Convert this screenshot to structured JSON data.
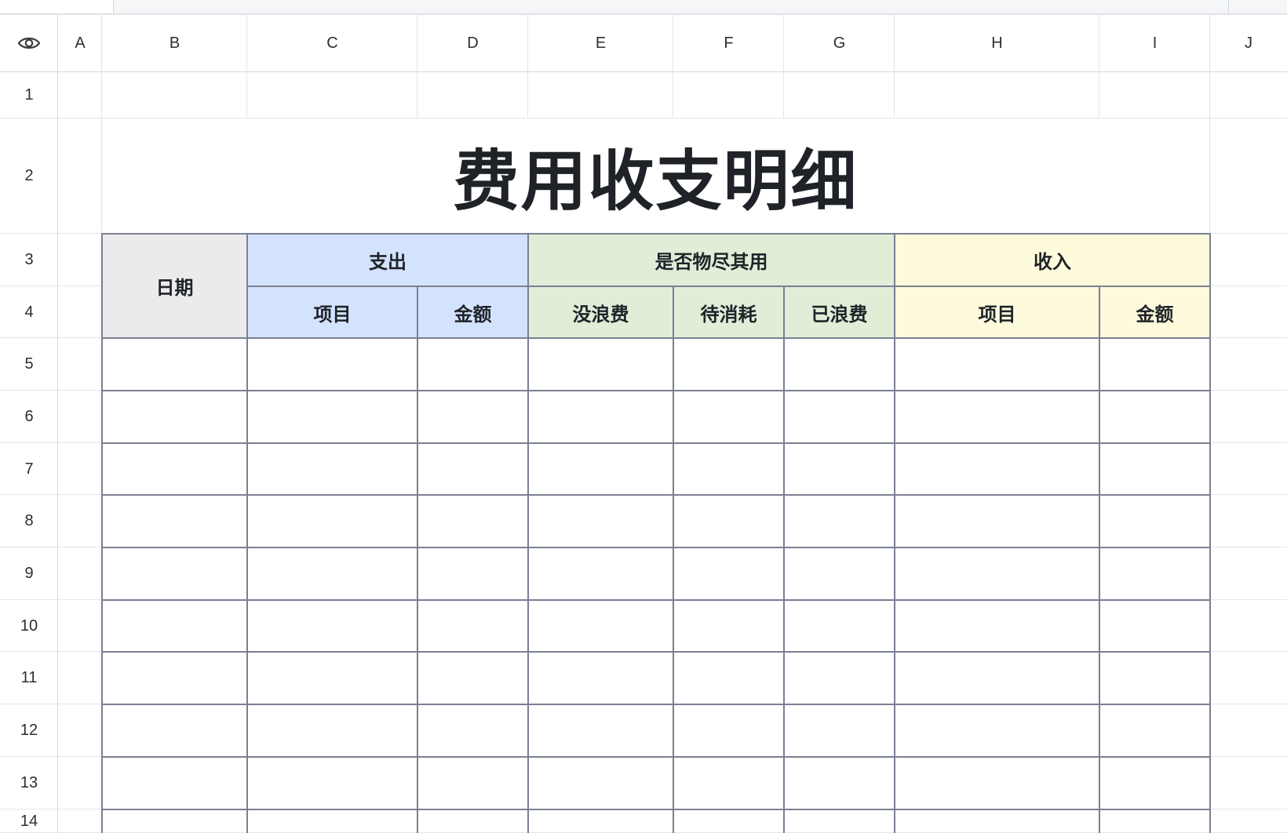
{
  "columns": [
    "A",
    "B",
    "C",
    "D",
    "E",
    "F",
    "G",
    "H",
    "I",
    "J"
  ],
  "rows": [
    "1",
    "2",
    "3",
    "4",
    "5",
    "6",
    "7",
    "8",
    "9",
    "10",
    "11",
    "12",
    "13",
    "14"
  ],
  "sheet": {
    "title": "费用收支明细",
    "headers": {
      "date": "日期",
      "expense": "支出",
      "expense_item": "项目",
      "expense_amount": "金额",
      "usage": "是否物尽其用",
      "usage_not_wasted": "没浪费",
      "usage_pending": "待消耗",
      "usage_wasted": "已浪费",
      "income": "收入",
      "income_item": "项目",
      "income_amount": "金额"
    }
  },
  "colors": {
    "date_header_bg": "#ebebeb",
    "expense_header_bg": "#d4e3fd",
    "usage_header_bg": "#e0eed8",
    "income_header_bg": "#fefadc",
    "table_border": "#7b7f93",
    "grid_line": "#e3e5e8"
  },
  "icons": {
    "visibility": "eye-icon"
  }
}
